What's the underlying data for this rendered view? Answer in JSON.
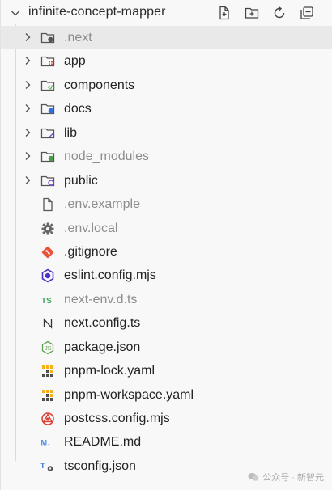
{
  "header": {
    "title": "infinite-concept-mapper",
    "actions": [
      "new-file-icon",
      "new-folder-icon",
      "refresh-icon",
      "collapse-all-icon"
    ]
  },
  "tree": [
    {
      "name": ".next",
      "kind": "folder",
      "icon": "folder-next-icon",
      "dim": true,
      "selected": true
    },
    {
      "name": "app",
      "kind": "folder",
      "icon": "folder-app-icon",
      "dim": false
    },
    {
      "name": "components",
      "kind": "folder",
      "icon": "folder-components-icon",
      "dim": false
    },
    {
      "name": "docs",
      "kind": "folder",
      "icon": "folder-docs-icon",
      "dim": false
    },
    {
      "name": "lib",
      "kind": "folder",
      "icon": "folder-lib-icon",
      "dim": false
    },
    {
      "name": "node_modules",
      "kind": "folder",
      "icon": "folder-node-icon",
      "dim": true
    },
    {
      "name": "public",
      "kind": "folder",
      "icon": "folder-public-icon",
      "dim": false
    },
    {
      "name": ".env.example",
      "kind": "file",
      "icon": "file-icon",
      "dim": true
    },
    {
      "name": ".env.local",
      "kind": "file",
      "icon": "gear-icon",
      "dim": true
    },
    {
      "name": ".gitignore",
      "kind": "file",
      "icon": "git-icon",
      "dim": false
    },
    {
      "name": "eslint.config.mjs",
      "kind": "file",
      "icon": "eslint-icon",
      "dim": false
    },
    {
      "name": "next-env.d.ts",
      "kind": "file",
      "icon": "typescript-icon",
      "dim": true
    },
    {
      "name": "next.config.ts",
      "kind": "file",
      "icon": "nextjs-icon",
      "dim": false
    },
    {
      "name": "package.json",
      "kind": "file",
      "icon": "nodejs-icon",
      "dim": false
    },
    {
      "name": "pnpm-lock.yaml",
      "kind": "file",
      "icon": "pnpm-icon",
      "dim": false
    },
    {
      "name": "pnpm-workspace.yaml",
      "kind": "file",
      "icon": "pnpm-icon",
      "dim": false
    },
    {
      "name": "postcss.config.mjs",
      "kind": "file",
      "icon": "postcss-icon",
      "dim": false
    },
    {
      "name": "README.md",
      "kind": "file",
      "icon": "markdown-icon",
      "dim": false
    },
    {
      "name": "tsconfig.json",
      "kind": "file",
      "icon": "tsconfig-icon",
      "dim": false
    }
  ],
  "watermark": {
    "text": "公众号 · 新智元"
  },
  "colors": {
    "background": "#f8f8f8",
    "selected_row": "#e9e9e9",
    "text": "#222222",
    "dim_text": "#8d8d8d"
  }
}
